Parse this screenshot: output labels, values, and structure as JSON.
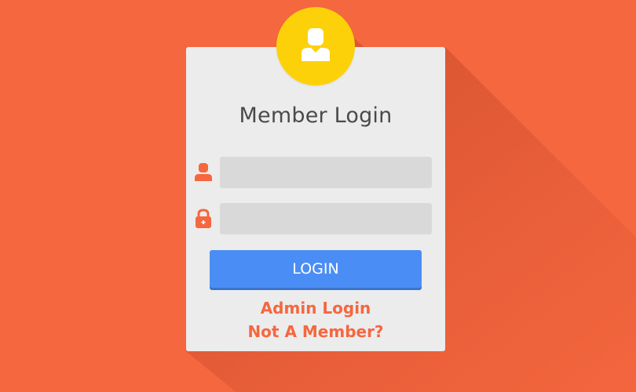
{
  "form": {
    "title": "Member Login",
    "username_value": "",
    "password_value": "",
    "login_label": "LOGIN"
  },
  "links": {
    "admin_login": "Admin Login",
    "not_member": "Not A Member?"
  },
  "icons": {
    "avatar": "user-avatar-icon",
    "username": "user-icon",
    "password": "lock-icon"
  },
  "colors": {
    "background": "#f5673f",
    "card": "#ececec",
    "avatar": "#fdd10a",
    "input": "#d9d9d9",
    "button": "#4a8ef5",
    "link": "#f5673f"
  }
}
